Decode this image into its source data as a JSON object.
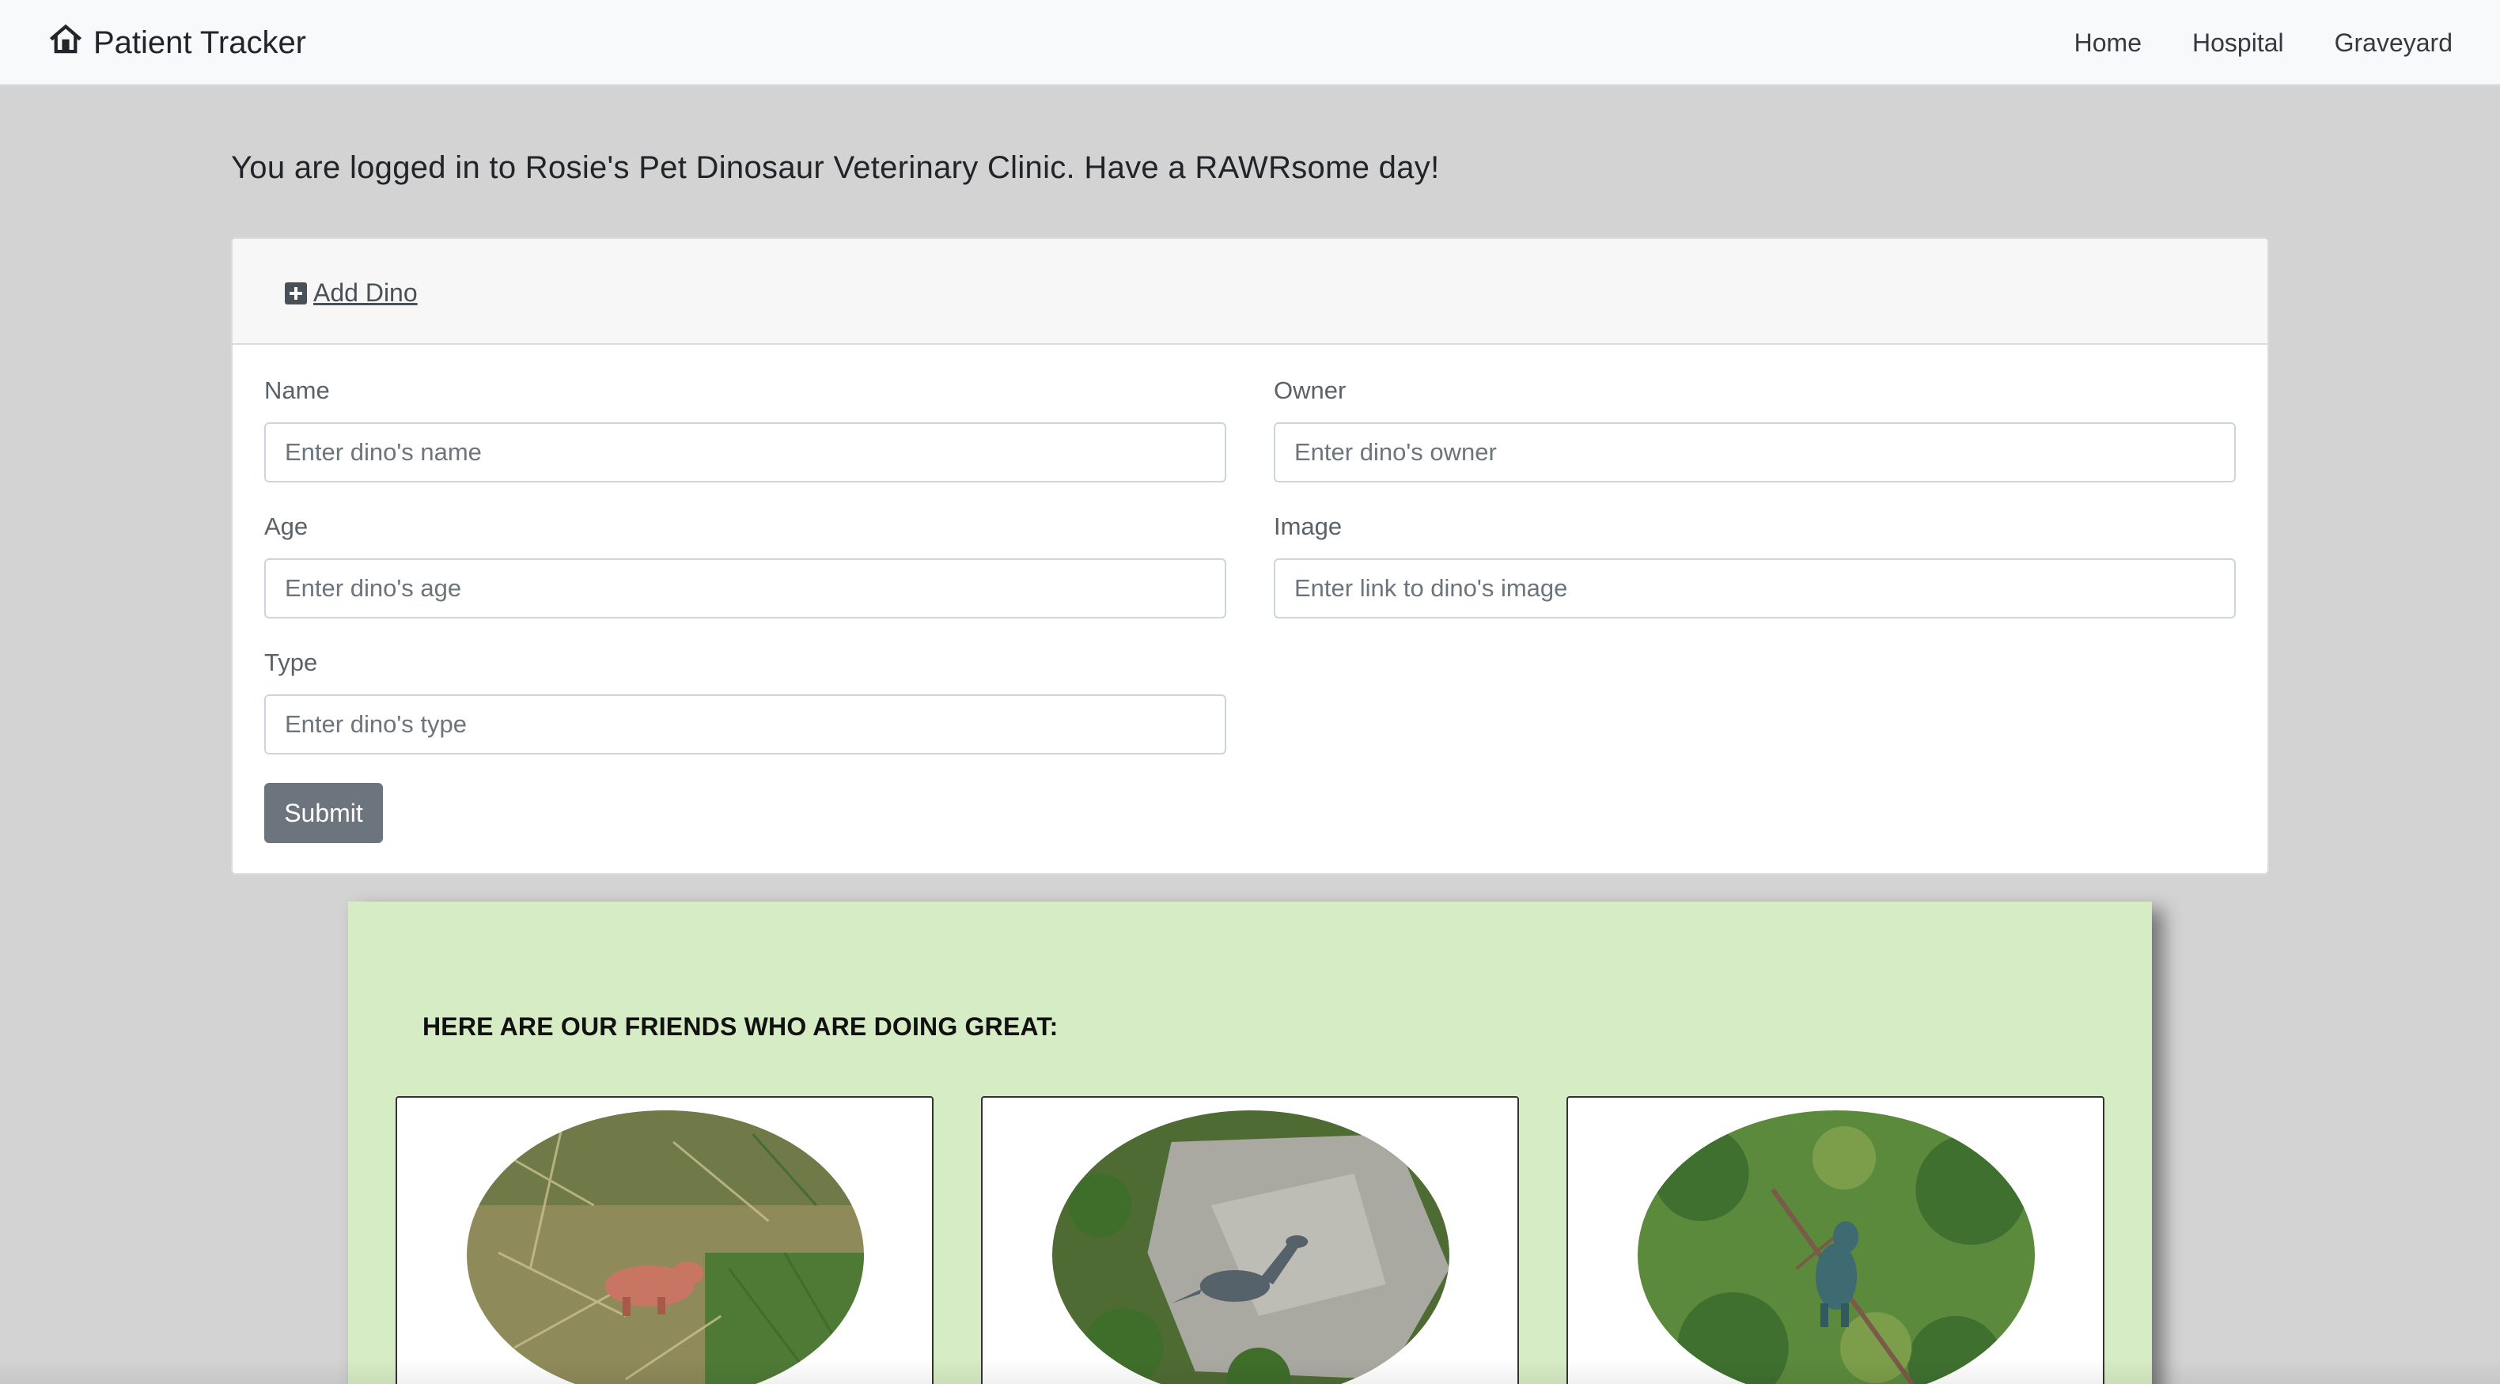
{
  "navbar": {
    "brand": "Patient Tracker",
    "brand_icon": "home-icon",
    "links": [
      "Home",
      "Hospital",
      "Graveyard"
    ]
  },
  "welcome": "You are logged in to Rosie's Pet Dinosaur Veterinary Clinic. Have a RAWRsome day!",
  "form": {
    "header_label": "Add Dino",
    "header_icon": "plus-square-icon",
    "name": {
      "label": "Name",
      "placeholder": "Enter dino's name"
    },
    "owner": {
      "label": "Owner",
      "placeholder": "Enter dino's owner"
    },
    "age": {
      "label": "Age",
      "placeholder": "Enter dino's age"
    },
    "image": {
      "label": "Image",
      "placeholder": "Enter link to dino's image"
    },
    "type": {
      "label": "Type",
      "placeholder": "Enter dino's type"
    },
    "submit_label": "Submit"
  },
  "friends": {
    "heading": "HERE ARE OUR FRIENDS WHO ARE DOING GREAT:",
    "cards": [
      {
        "photo": "red-dino-in-grass-photo"
      },
      {
        "photo": "gray-dino-on-rock-photo"
      },
      {
        "photo": "teal-dino-in-grass-photo"
      }
    ]
  },
  "colors": {
    "page_bg": "#d3d3d3",
    "navbar_bg": "#f8f9fa",
    "green_panel": "#d6ecc4",
    "submit_bg": "#6c757d"
  }
}
